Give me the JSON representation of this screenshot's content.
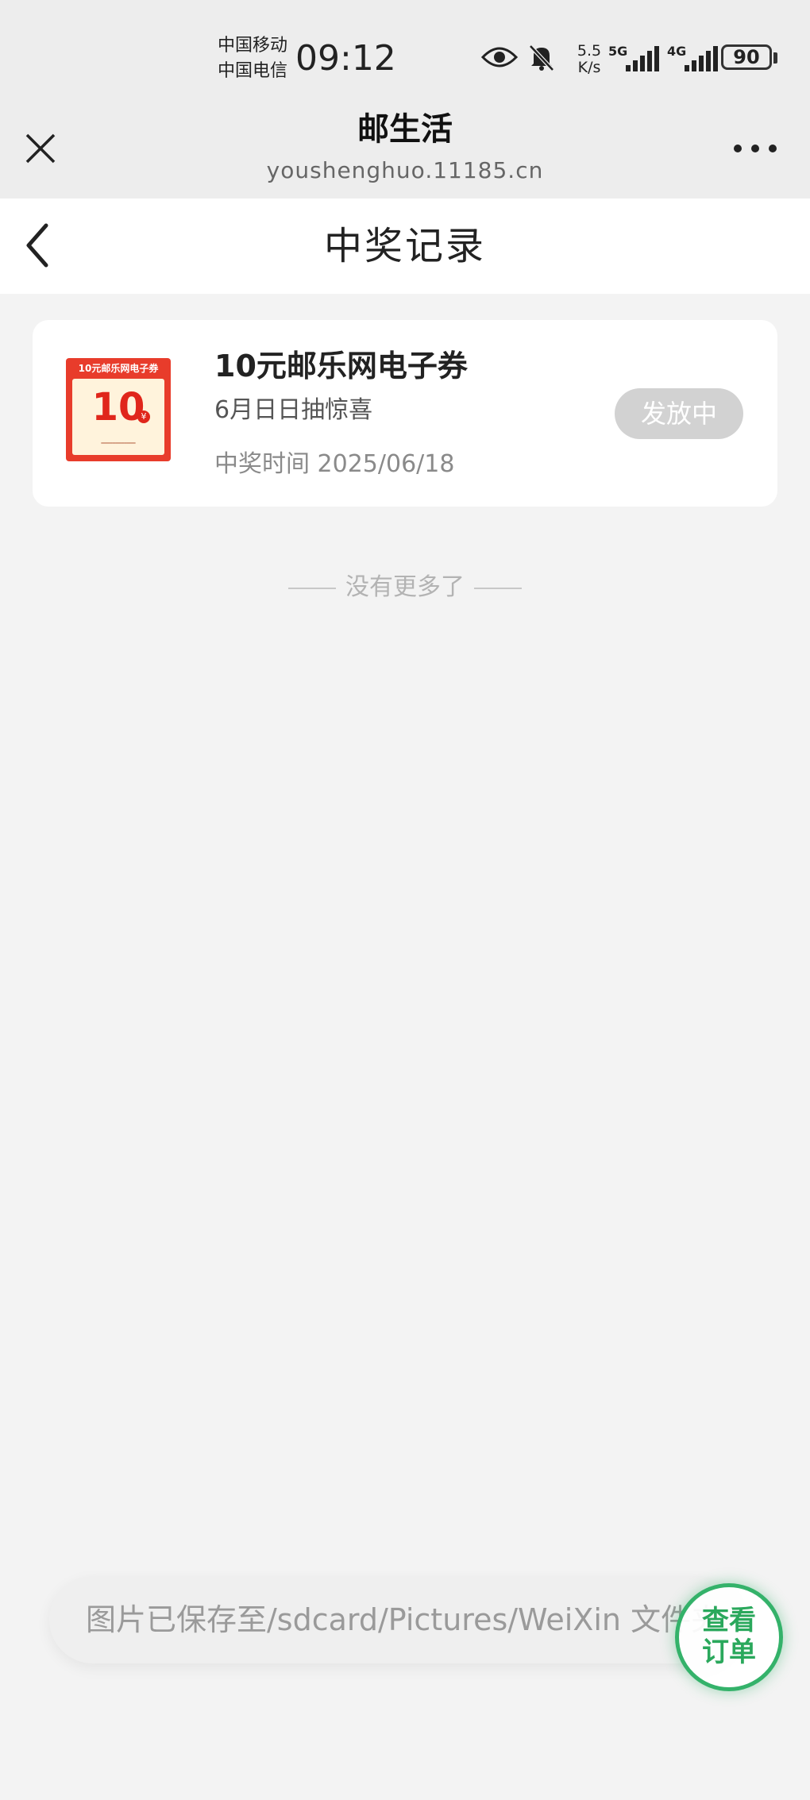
{
  "status_bar": {
    "carrier_1": "中国移动",
    "carrier_2": "中国电信",
    "time": "09:12",
    "speed_value": "5.5",
    "speed_unit": "K/s",
    "network_1": "5G",
    "network_2": "4G",
    "battery": "90"
  },
  "wechat_bar": {
    "title": "邮生活",
    "url": "youshenghuo.11185.cn"
  },
  "page": {
    "title": "中奖记录"
  },
  "prize_record": {
    "coupon_banner": "10元邮乐网电子券",
    "coupon_value": "10",
    "coupon_currency": "¥",
    "name": "10元邮乐网电子券",
    "activity": "6月日日抽惊喜",
    "time_label": "中奖时间",
    "time_value": "2025/06/18",
    "status": "发放中"
  },
  "list_end": "没有更多了",
  "toast": "图片已保存至/sdcard/Pictures/WeiXin 文件夹",
  "floating_button": {
    "line1": "查看",
    "line2": "订单"
  },
  "colors": {
    "accent_green": "#34b26a",
    "coupon_red": "#e83c2b",
    "pill_grey": "#d2d2d2"
  }
}
